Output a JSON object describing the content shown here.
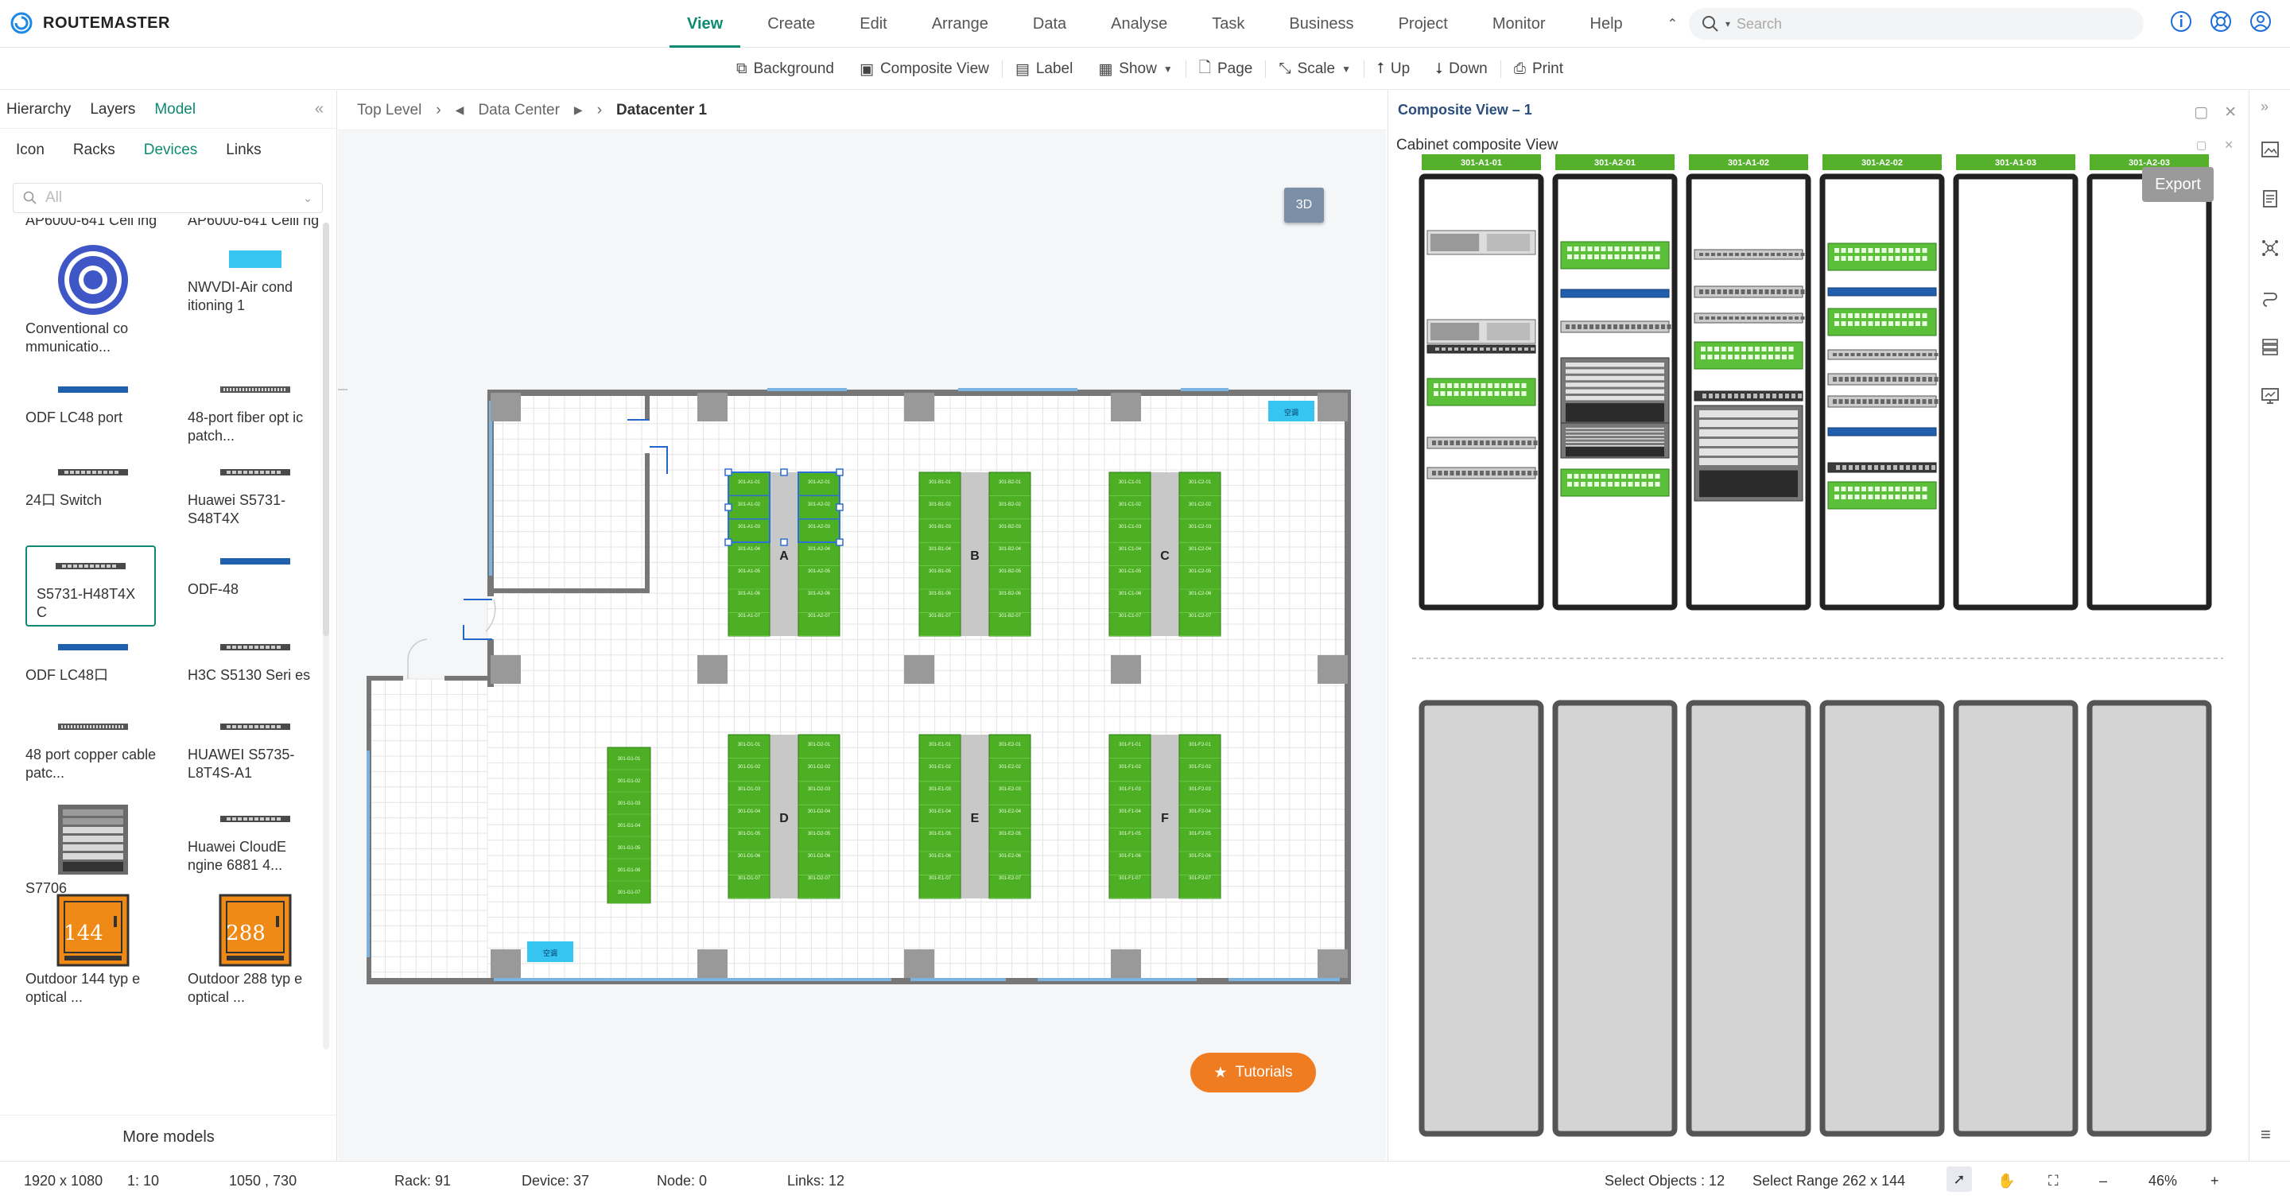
{
  "app": {
    "name": "ROUTEMASTER"
  },
  "menu": [
    "View",
    "Create",
    "Edit",
    "Arrange",
    "Data",
    "Analyse",
    "Task",
    "Business",
    "Project",
    "Monitor",
    "Help"
  ],
  "menu_active": "View",
  "search": {
    "placeholder": "Search"
  },
  "toolbar": {
    "background": "Background",
    "composite_view": "Composite View",
    "label": "Label",
    "show": "Show",
    "page": "Page",
    "scale": "Scale",
    "up": "Up",
    "down": "Down",
    "print": "Print"
  },
  "left": {
    "tabs": {
      "hierarchy": "Hierarchy",
      "layers": "Layers",
      "model": "Model"
    },
    "subtabs": {
      "icon": "Icon",
      "racks": "Racks",
      "devices": "Devices",
      "links": "Links"
    },
    "filter_placeholder": "All",
    "devices": [
      {
        "label": "AP6000-641 Ceil ing",
        "icon": "ap-icon"
      },
      {
        "label": "AP6000-641 Ceili ng",
        "icon": "ap-icon"
      },
      {
        "label": "Conventional co mmunicatio...",
        "icon": "comm-device-icon"
      },
      {
        "label": "NWVDI-Air cond itioning 1",
        "icon": "air-conditioner-icon"
      },
      {
        "label": "ODF LC48 port",
        "icon": "odf-icon"
      },
      {
        "label": "48-port fiber opt ic patch...",
        "icon": "patch-panel-icon"
      },
      {
        "label": "24口 Switch",
        "icon": "switch-icon"
      },
      {
        "label": "Huawei S5731-S48T4X",
        "icon": "switch-icon"
      },
      {
        "label": "S5731-H48T4X C",
        "icon": "switch-icon"
      },
      {
        "label": "ODF-48",
        "icon": "odf-icon"
      },
      {
        "label": "ODF LC48口",
        "icon": "odf-icon"
      },
      {
        "label": "H3C S5130 Seri es",
        "icon": "switch-icon"
      },
      {
        "label": "48 port copper cable patc...",
        "icon": "patch-panel-icon"
      },
      {
        "label": "HUAWEI S5735-L8T4S-A1",
        "icon": "switch-icon"
      },
      {
        "label": "S7706",
        "icon": "chassis-icon"
      },
      {
        "label": "Huawei CloudE ngine 6881 4...",
        "icon": "switch-icon"
      },
      {
        "label": "Outdoor 144 typ e optical ...",
        "icon": "outdoor-box-icon",
        "number": "144"
      },
      {
        "label": "Outdoor 288 typ e optical ...",
        "icon": "outdoor-box-icon",
        "number": "288"
      }
    ],
    "more": "More models"
  },
  "breadcrumbs": {
    "top": "Top Level",
    "mid": "Data Center",
    "current": "Datacenter 1"
  },
  "canvas": {
    "btn_3d": "3D",
    "tutorials": "Tutorials",
    "rooms": [
      {
        "letter": "A",
        "left_prefix": "301-A1-0",
        "right_prefix": "301-A2-0"
      },
      {
        "letter": "B",
        "left_prefix": "301-B1-0",
        "right_prefix": "301-B2-0"
      },
      {
        "letter": "C",
        "left_prefix": "301-C1-0",
        "right_prefix": "301-C2-0"
      },
      {
        "letter": "D",
        "left_prefix": "301-D1-0",
        "right_prefix": "301-D2-0"
      },
      {
        "letter": "E",
        "left_prefix": "301-E1-0",
        "right_prefix": "301-E2-0"
      },
      {
        "letter": "F",
        "left_prefix": "301-F1-0",
        "right_prefix": "301-F2-0"
      }
    ],
    "single_prefix": "301-G1-0",
    "ac_label": "空调"
  },
  "right": {
    "title": "Composite View – 1",
    "subtitle": "Cabinet composite View",
    "export": "Export",
    "cabinets": [
      "301-A1-01",
      "301-A2-01",
      "301-A1-02",
      "301-A2-02",
      "301-A1-03",
      "301-A2-03"
    ]
  },
  "status": {
    "resolution": "1920 x 1080",
    "ratio": "1: 10",
    "coords": "1050 , 730",
    "rack": "Rack: 91",
    "device": "Device: 37",
    "node": "Node: 0",
    "links": "Links: 12",
    "select_objects": "Select Objects :  12",
    "select_range": "Select Range  262 x 144",
    "zoom": "46%"
  },
  "colors": {
    "accent": "#0d8a72",
    "rack_green": "#4caf24",
    "tutorial": "#f07c22",
    "title_blue": "#2a4d7a"
  }
}
